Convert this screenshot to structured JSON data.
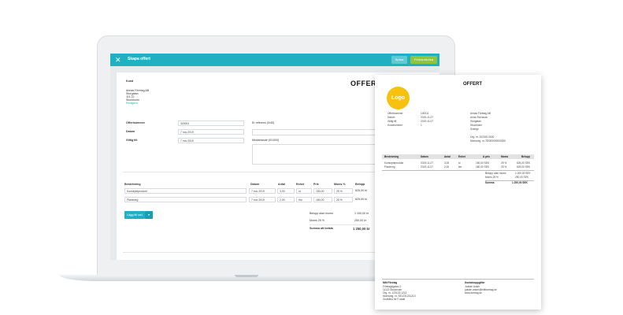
{
  "app": {
    "title": "Skapa offert",
    "save_label": "Spara",
    "preview_label": "Förhandsvisa",
    "close_glyph": "✕"
  },
  "doc": {
    "heading": "OFFERT",
    "customer_label": "Kund",
    "customer_lines": [
      "Annas Företag AB",
      "Storgatan",
      "111 22",
      "Stockholm"
    ],
    "customer_link": "Redigera",
    "offer_no_label": "Offertnummer",
    "offer_no_value": "320001",
    "date_label": "Datum",
    "date_value": "7 nov 2019",
    "valid_label": "Giltig till",
    "valid_value": "7 nov 2019",
    "reference_label": "Er referens (0/40)",
    "message_label": "Meddelande (0/1000)",
    "columns": [
      "Beskrivning",
      "Datum",
      "Antal",
      "Enhet",
      "Pris",
      "Moms %",
      "Belopp"
    ],
    "rows": [
      {
        "desc": "Konsepteprodukt",
        "date": "7 nov 2019",
        "qty": "3,00",
        "unit": "st",
        "price": "150,00",
        "vat": "25 %",
        "amount": "625,00 kr"
      },
      {
        "desc": "Planering",
        "date": "7 nov 2019",
        "qty": "2,00",
        "unit": "tim",
        "price": "180,00",
        "vat": "25 %",
        "amount": "625,00 kr"
      }
    ],
    "add_row_label": "Lägg till rad",
    "totals": [
      {
        "label": "Belopp utan moms",
        "value": "1 100,00 kr"
      },
      {
        "label": "Moms 25 %",
        "value": "250,00 kr"
      }
    ],
    "total_label": "Summa att betala",
    "total_value": "1 250,00 kr"
  },
  "paper": {
    "title": "OFFERT",
    "logo_text": "Logo",
    "meta": [
      {
        "label": "Offertnummer",
        "value": "100011"
      },
      {
        "label": "Datum",
        "value": "2019-11-07"
      },
      {
        "label": "Giltig till",
        "value": "2019-11-07"
      },
      {
        "label": "Kundnummer",
        "value": "1"
      }
    ],
    "recipient": [
      "Annas Företag AB",
      "Anna Svensson",
      "Storgatan",
      "Stockholm",
      "Sverige"
    ],
    "ref_lines": [
      "Org. nr. 202020-0000",
      "Momsreg. nr. SE000000000000"
    ],
    "columns": [
      "Beskrivning",
      "Datum",
      "Antal",
      "Enhet",
      "A pris",
      "Moms",
      "Belopp"
    ],
    "rows": [
      {
        "desc": "Konsepteprodukt",
        "date": "2019-11-07",
        "qty": "3,00",
        "unit": "st",
        "price": "150,00 SEK",
        "vat": "25 %",
        "amount": "625,00 SEK"
      },
      {
        "desc": "Planering",
        "date": "2019-11-07",
        "qty": "2,00",
        "unit": "tim",
        "price": "180,00 SEK",
        "vat": "25 %",
        "amount": "625,00 SEK"
      }
    ],
    "totals": [
      {
        "label": "Belopp utan moms",
        "value": "1 000,00 SEK"
      },
      {
        "label": "Moms 25 %",
        "value": "250,00 SEK"
      }
    ],
    "sum_label": "Summa",
    "sum_value": "1 250,00 SEK",
    "footer_left_title": "Mitt Företag",
    "footer_left": [
      "Företagsgatan 2",
      "11122 Stockholm",
      "Org. nr. 123123-1213",
      "Momsreg. nr. SE1231231213",
      "Godkänd för F-skatt"
    ],
    "footer_right_title": "Kontaktuppgifter",
    "footer_right": [
      "Joakim Anker",
      "joakim.anker@mittforetag.se",
      "www.foretag.se"
    ]
  }
}
